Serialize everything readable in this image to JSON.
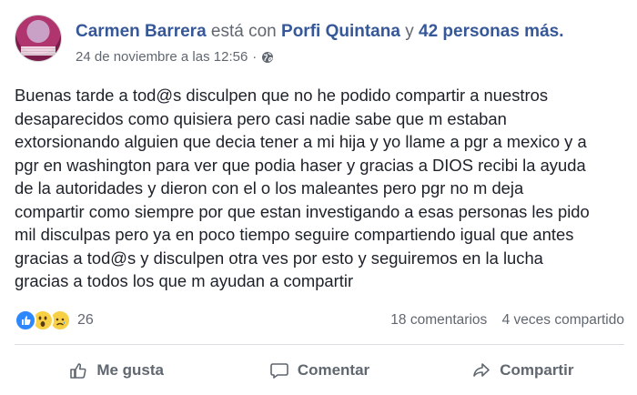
{
  "post": {
    "author": "Carmen Barrera",
    "with_text": "está con",
    "tagged_person": "Porfi Quintana",
    "and_text": "y",
    "others": "42 personas más.",
    "timestamp": "24 de noviembre a las 12:56",
    "separator": "·",
    "audience_icon": "globe-icon",
    "text": "Buenas tarde a tod@s disculpen que no he podido compartir a nuestros\ndesaparecidos como quisiera pero casi nadie sabe que m estaban\nextorsionando alguien que decia tener a mi hija y yo llame a pgr a mexico y a\npgr en washington para ver que podia haser y gracias a DIOS recibi la ayuda\nde la autoridades y dieron con el o los maleantes pero pgr no m deja\ncompartir como siempre por que estan investigando a esas personas les pido\nmil disculpas pero ya en poco tiempo seguire compartiendo igual que antes\ngracias a tod@s y disculpen otra ves por esto y seguiremos en la lucha\ngracias a todos los que m ayudan a compartir"
  },
  "reactions": {
    "icons": [
      "like-icon",
      "wow-icon",
      "sad-icon"
    ],
    "count": "26"
  },
  "stats": {
    "comments": "18 comentarios",
    "shares": "4 veces compartido"
  },
  "actions": {
    "like": "Me gusta",
    "comment": "Comentar",
    "share": "Compartir"
  },
  "colors": {
    "link": "#365899",
    "secondary_text": "#616770",
    "like_blue": "#2d88ff",
    "emoji_yellow": "#f7d046"
  }
}
